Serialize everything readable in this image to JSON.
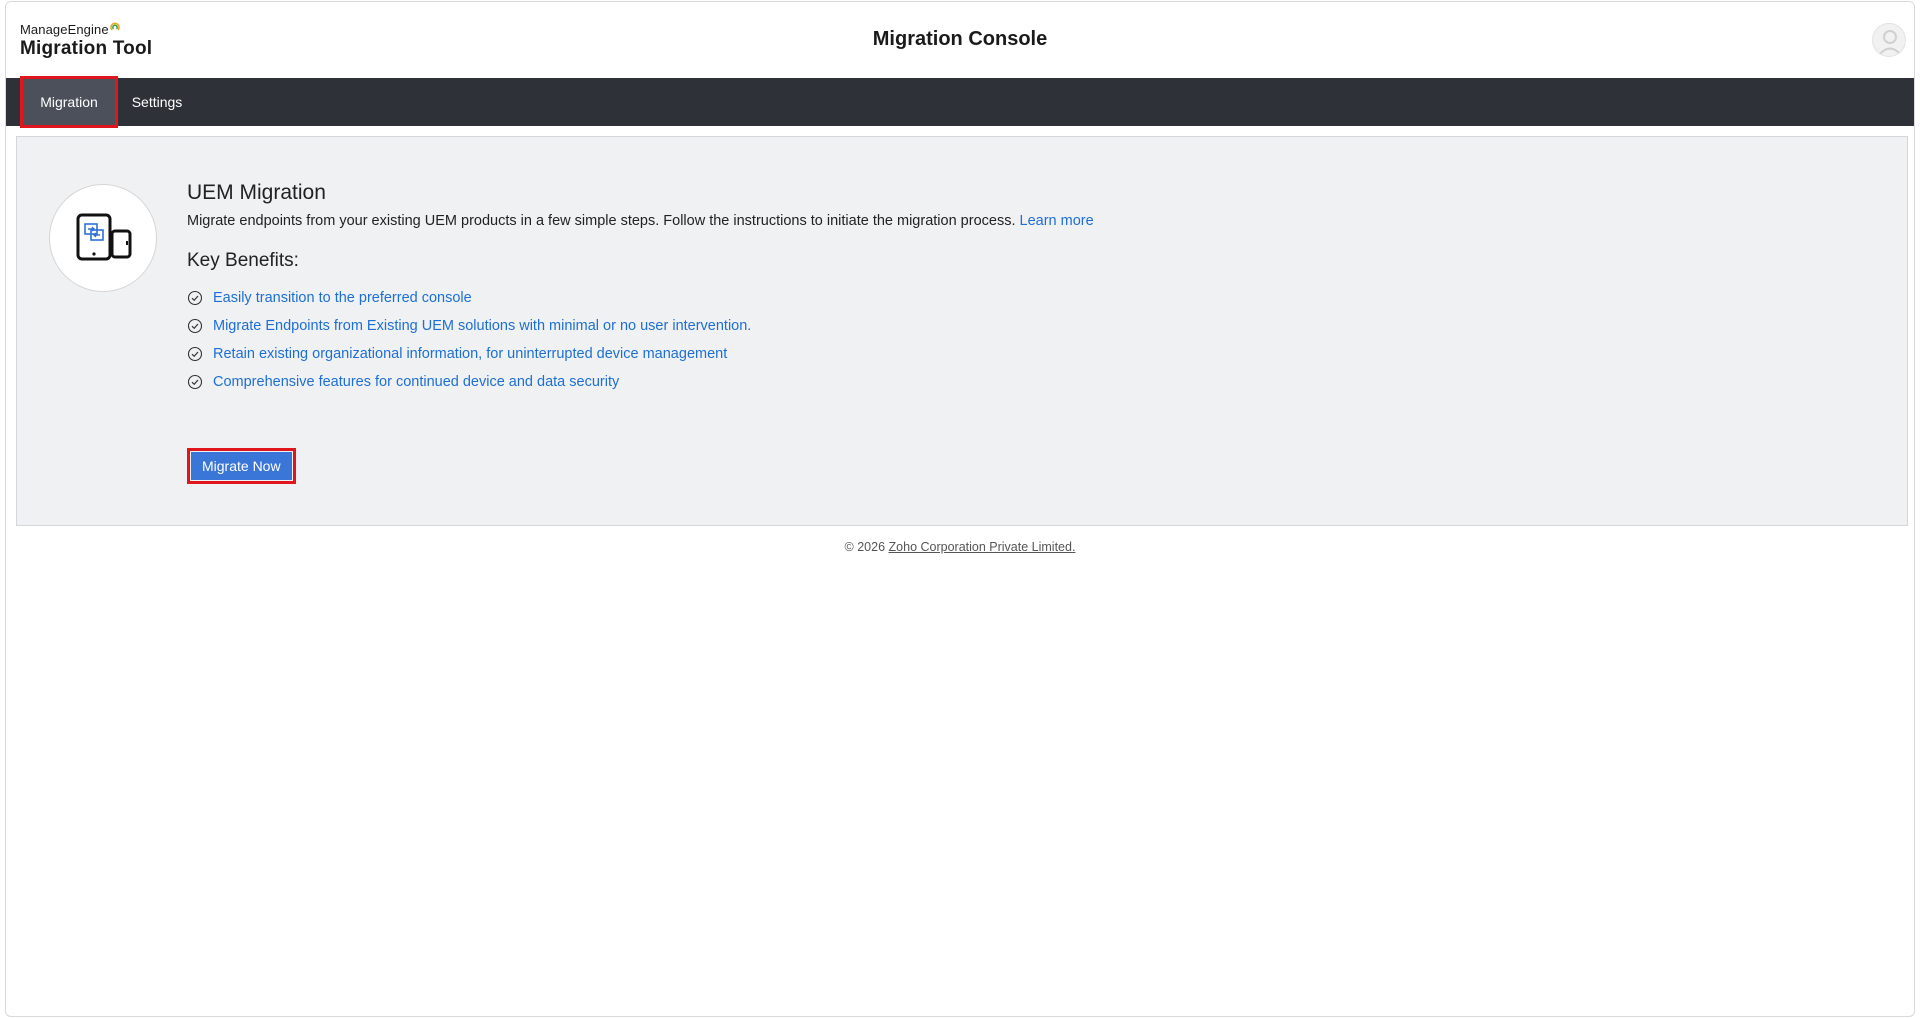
{
  "header": {
    "brand_top": "ManageEngine",
    "brand_bottom": "Migration Tool",
    "title": "Migration Console"
  },
  "nav": {
    "tabs": [
      {
        "label": "Migration",
        "active": true
      },
      {
        "label": "Settings",
        "active": false
      }
    ]
  },
  "main": {
    "icon": "device-migration-icon",
    "title": "UEM Migration",
    "description": "Migrate endpoints from your existing UEM products in a few simple steps. Follow the instructions to initiate the migration process.",
    "learn_more": "Learn more",
    "benefits_title": "Key Benefits:",
    "benefits": [
      "Easily transition to the preferred console",
      "Migrate Endpoints from Existing UEM solutions with minimal or no user intervention.",
      "Retain existing organizational information, for uninterrupted device management",
      "Comprehensive features for continued device and data security"
    ],
    "migrate_button": "Migrate Now"
  },
  "footer": {
    "copyright": "© 2026",
    "company": "Zoho Corporation Private Limited."
  },
  "colors": {
    "nav_bg": "#2e3138",
    "nav_active": "#4b505a",
    "highlight": "#e0161e",
    "link": "#1d6fd6",
    "button": "#3a76d8",
    "panel_bg": "#f0f1f3"
  }
}
